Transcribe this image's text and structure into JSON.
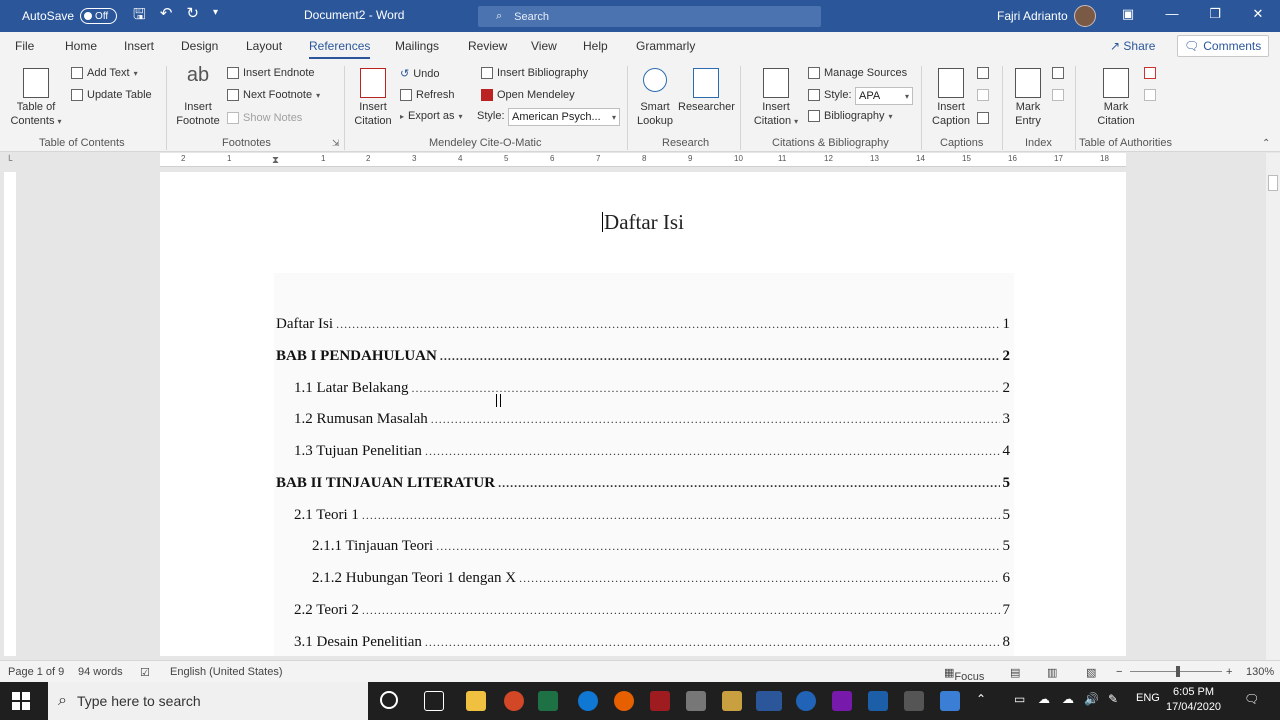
{
  "titlebar": {
    "autosave_label": "AutoSave",
    "autosave_state": "Off",
    "document_title": "Document2 - Word",
    "search_placeholder": "Search",
    "user_name": "Fajri Adrianto"
  },
  "tabs": [
    "File",
    "Home",
    "Insert",
    "Design",
    "Layout",
    "References",
    "Mailings",
    "Review",
    "View",
    "Help",
    "Grammarly"
  ],
  "active_tab": "References",
  "share_label": "Share",
  "comments_label": "Comments",
  "ribbon": {
    "toc_group": {
      "label": "Table of Contents",
      "toc_button": "Table of Contents",
      "add_text": "Add Text",
      "update_table": "Update Table"
    },
    "footnotes_group": {
      "label": "Footnotes",
      "insert_footnote": "Insert Footnote",
      "insert_endnote": "Insert Endnote",
      "next_footnote": "Next Footnote",
      "show_notes": "Show Notes"
    },
    "mendeley_group": {
      "label": "Mendeley Cite-O-Matic",
      "insert_citation": "Insert Citation",
      "undo": "Undo",
      "refresh": "Refresh",
      "export_as": "Export as",
      "style_label": "Style:",
      "style_value": "American Psych...",
      "insert_bibliography": "Insert Bibliography",
      "open_mendeley": "Open Mendeley"
    },
    "research_group": {
      "label": "Research",
      "smart_lookup": "Smart Lookup",
      "researcher": "Researcher"
    },
    "citations_group": {
      "label": "Citations & Bibliography",
      "insert_citation": "Insert Citation",
      "manage_sources": "Manage Sources",
      "style_label": "Style:",
      "style_value": "APA",
      "bibliography": "Bibliography"
    },
    "captions_group": {
      "label": "Captions",
      "insert_caption": "Insert Caption"
    },
    "index_group": {
      "label": "Index",
      "mark_entry": "Mark Entry"
    },
    "authorities_group": {
      "label": "Table of Authorities",
      "mark_citation": "Mark Citation"
    }
  },
  "ruler_numbers": [
    "2",
    "1",
    "1",
    "1",
    "2",
    "3",
    "4",
    "5",
    "6",
    "7",
    "8",
    "9",
    "10",
    "11",
    "12",
    "13",
    "14",
    "15",
    "16",
    "17",
    "18"
  ],
  "document": {
    "heading": "Daftar Isi",
    "toc": [
      {
        "text": "Daftar Isi",
        "page": "1",
        "level": 0,
        "bold": false
      },
      {
        "text": "BAB I PENDAHULUAN",
        "page": "2",
        "level": 0,
        "bold": true
      },
      {
        "text": "1.1 Latar Belakang",
        "page": "2",
        "level": 1,
        "bold": false
      },
      {
        "text": "1.2 Rumusan Masalah",
        "page": "3",
        "level": 1,
        "bold": false
      },
      {
        "text": "1.3 Tujuan Penelitian",
        "page": "4",
        "level": 1,
        "bold": false
      },
      {
        "text": "BAB II TINJAUAN LITERATUR",
        "page": "5",
        "level": 0,
        "bold": true
      },
      {
        "text": "2.1 Teori 1",
        "page": "5",
        "level": 1,
        "bold": false
      },
      {
        "text": "2.1.1 Tinjauan Teori",
        "page": "5",
        "level": 2,
        "bold": false
      },
      {
        "text": "2.1.2 Hubungan Teori 1 dengan X",
        "page": "6",
        "level": 2,
        "bold": false
      },
      {
        "text": "2.2 Teori 2",
        "page": "7",
        "level": 1,
        "bold": false
      },
      {
        "text": "3.1 Desain Penelitian",
        "page": "8",
        "level": 1,
        "bold": false
      }
    ]
  },
  "statusbar": {
    "page_info": "Page 1 of 9",
    "word_count": "94 words",
    "language": "English (United States)",
    "focus": "Focus",
    "zoom": "130%"
  },
  "taskbar": {
    "search_placeholder": "Type here to search",
    "language": "ENG",
    "time": "6:05 PM",
    "date": "17/04/2020"
  }
}
